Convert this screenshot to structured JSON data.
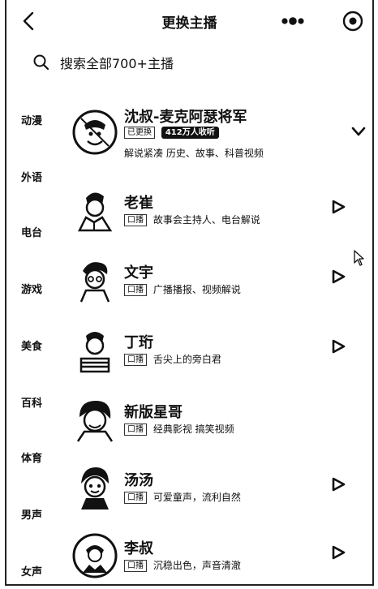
{
  "header": {
    "title": "更换主播"
  },
  "search": {
    "placeholder": "搜索全部700+主播"
  },
  "categories": [
    "动漫",
    "外语",
    "电台",
    "游戏",
    "美食",
    "百科",
    "体育",
    "男声",
    "女声"
  ],
  "anchors": [
    {
      "name": "沈叔-麦克阿瑟将军",
      "tag": "已更换",
      "badge": "412万人收听",
      "desc": "解说紧凑 历史、故事、科普视频"
    },
    {
      "name": "老崔",
      "tag": "口播",
      "desc": "故事会主持人、电台解说"
    },
    {
      "name": "文宇",
      "tag": "口播",
      "desc": "广播播报、视频解说"
    },
    {
      "name": "丁珩",
      "tag": "口播",
      "desc": "舌尖上的旁白君"
    },
    {
      "name": "新版星哥",
      "tag": "口播",
      "desc": "经典影视 搞笑视频"
    },
    {
      "name": "汤汤",
      "tag": "口播",
      "desc": "可爱童声，流利自然"
    },
    {
      "name": "李叔",
      "tag": "口播",
      "desc": "沉稳出色，声音清澈"
    }
  ],
  "icons": {
    "back": "chevron-left-icon",
    "more": "more-dots-icon",
    "record": "record-icon",
    "search": "search-icon",
    "play": "play-icon",
    "expand": "chevron-down-icon"
  }
}
